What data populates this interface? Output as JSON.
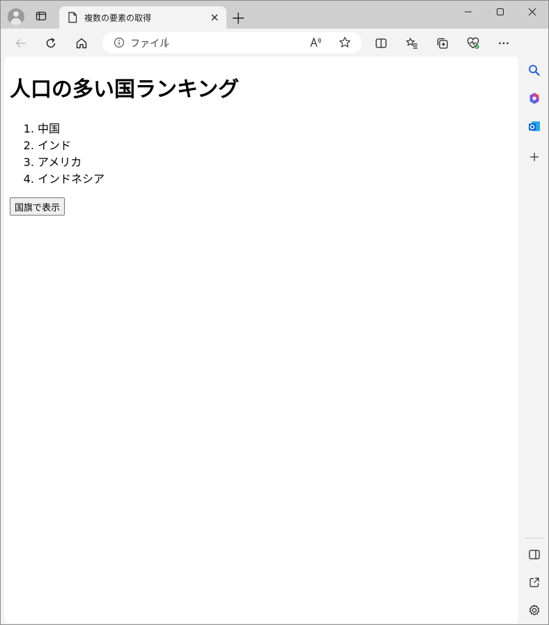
{
  "browser": {
    "tab": {
      "title": "複数の要素の取得"
    },
    "address": {
      "scheme_label": "ファイル",
      "url_value": ""
    },
    "colors": {
      "accent": "#0078d4",
      "tab_strip": "#cfcfcf",
      "toolbar": "#f3f3f3"
    }
  },
  "page": {
    "heading": "人口の多い国ランキング",
    "ranking": [
      {
        "label": "中国"
      },
      {
        "label": "インド"
      },
      {
        "label": "アメリカ"
      },
      {
        "label": "インドネシア"
      }
    ],
    "button_label": "国旗で表示"
  },
  "icons": {
    "toolbar": [
      "back-icon",
      "refresh-icon",
      "home-icon",
      "info-icon",
      "read-aloud-icon",
      "favorite-star-icon",
      "split-screen-icon",
      "favorites-icon",
      "collections-icon",
      "browser-essentials-icon",
      "more-icon",
      "copilot-icon"
    ],
    "sidebar": [
      "search-icon",
      "office-icon",
      "outlook-icon",
      "add-icon",
      "hide-sidebar-icon",
      "open-external-icon",
      "settings-icon"
    ]
  }
}
